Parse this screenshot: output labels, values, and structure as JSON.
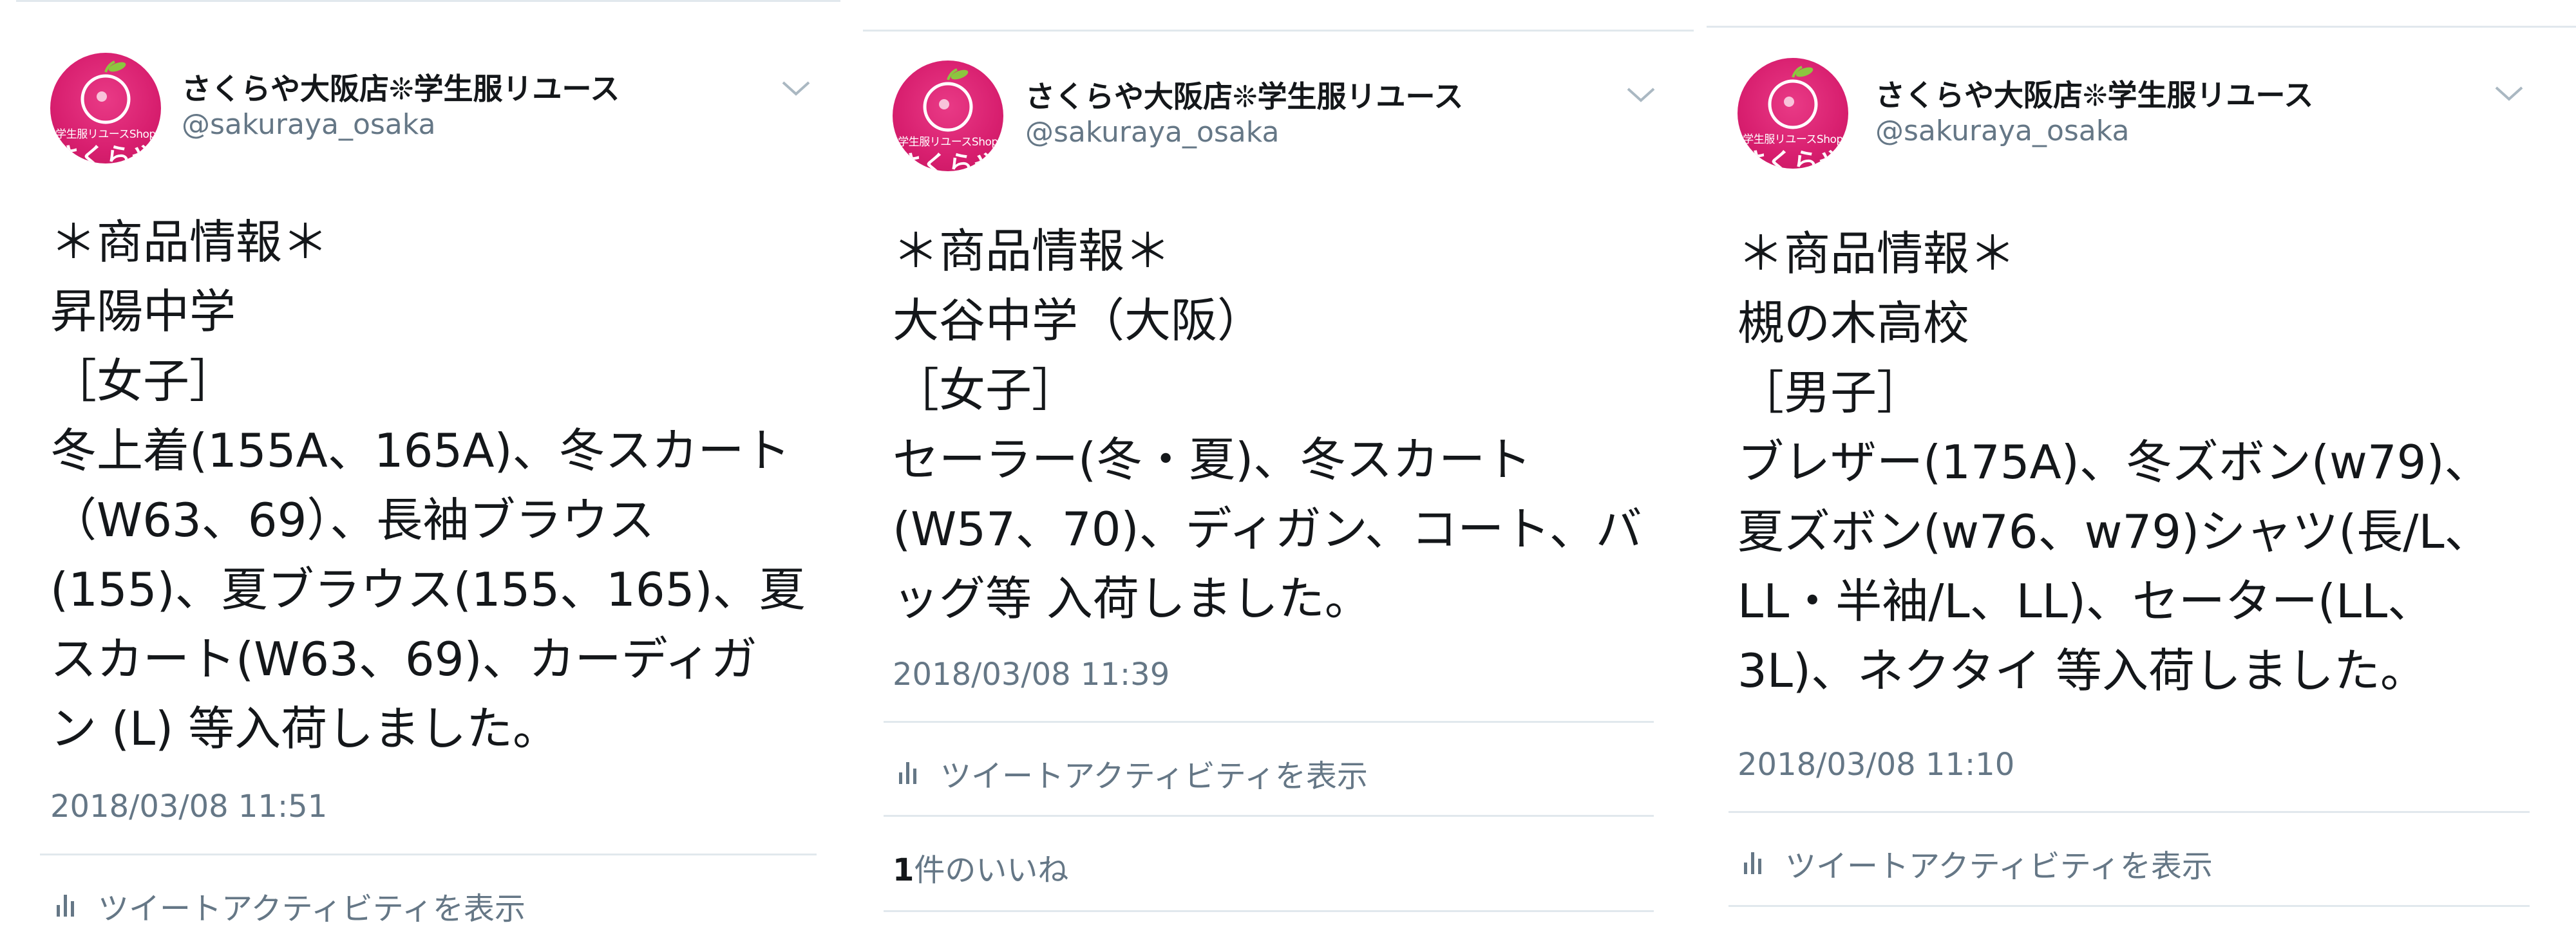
{
  "tweets": [
    {
      "avatar": {
        "shop": "学生服リユースShop",
        "name": "さくらや"
      },
      "display_name": "さくらや大阪店❊学生服リユース",
      "handle": "@sakuraya_osaka",
      "lines": [
        "＊商品情報＊",
        "昇陽中学",
        "［女子］",
        "冬上着(155A、165A)、冬スカート",
        "（W63、69）、長袖ブラウス",
        "(155)、夏ブラウス(155、165)、夏",
        "スカート(W63、69)、カーディガ",
        "ン (L) 等入荷しました。"
      ],
      "timestamp": "2018/03/08 11:51",
      "activity": "ツイートアクティビティを表示"
    },
    {
      "avatar": {
        "shop": "学生服リユースShop",
        "name": "さくらや"
      },
      "display_name": "さくらや大阪店❊学生服リユース",
      "handle": "@sakuraya_osaka",
      "lines": [
        "＊商品情報＊",
        "大谷中学（大阪）",
        "［女子］",
        "セーラー(冬・夏)、冬スカート",
        "(W57、70)、ディガン、コート、バ",
        "ッグ等 入荷しました。"
      ],
      "timestamp": "2018/03/08 11:39",
      "activity": "ツイートアクティビティを表示",
      "likes_count": "1",
      "likes_label": "件のいいね"
    },
    {
      "avatar": {
        "shop": "学生服リユースShop",
        "name": "さくらや"
      },
      "display_name": "さくらや大阪店❊学生服リユース",
      "handle": "@sakuraya_osaka",
      "lines": [
        "＊商品情報＊",
        "槻の木高校",
        "［男子］",
        "ブレザー(175A)、冬ズボン(w79)、",
        "夏ズボン(w76、w79)シャツ(長/L、",
        "LL・半袖/L、LL)、セーター(LL、",
        "3L)、ネクタイ 等入荷しました。"
      ],
      "timestamp": "2018/03/08 11:10",
      "activity": "ツイートアクティビティを表示"
    }
  ],
  "colors": {
    "text": "#14171a",
    "muted": "#657786",
    "divider": "#e1e8ed",
    "avatar": "#d81f6f"
  }
}
